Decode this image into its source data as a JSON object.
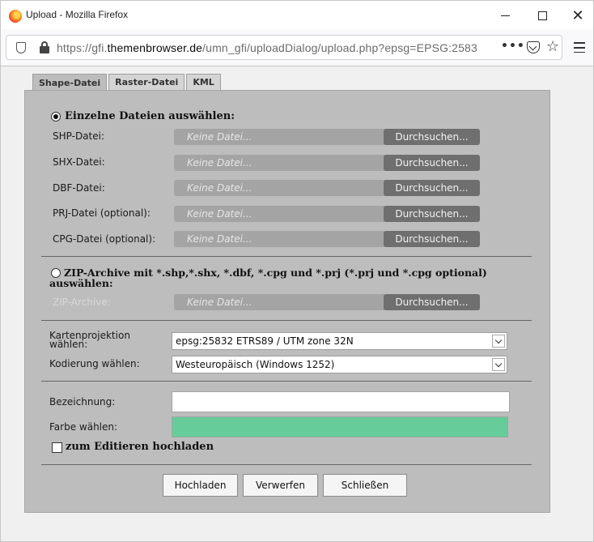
{
  "window": {
    "title": "Upload - Mozilla Firefox",
    "close_glyph": "✕"
  },
  "browser": {
    "url_prefix": "https://gfi.",
    "url_domain": "themenbrowser.de",
    "url_suffix": "/umn_gfi/uploadDialog/upload.php?epsg=EPSG:2583",
    "more_glyph": "•••",
    "star_glyph": "☆"
  },
  "tabs": [
    {
      "label": "Shape-Datei"
    },
    {
      "label": "Raster-Datei"
    },
    {
      "label": "KML"
    }
  ],
  "single_files": {
    "radio_label": "Einzelne Dateien auswählen:",
    "rows": [
      {
        "label": "SHP-Datei:",
        "placeholder": "Keine Datei...",
        "button": "Durchsuchen..."
      },
      {
        "label": "SHX-Datei:",
        "placeholder": "Keine Datei...",
        "button": "Durchsuchen..."
      },
      {
        "label": "DBF-Datei:",
        "placeholder": "Keine Datei...",
        "button": "Durchsuchen..."
      },
      {
        "label": "PRJ-Datei (optional):",
        "placeholder": "Keine Datei...",
        "button": "Durchsuchen..."
      },
      {
        "label": "CPG-Datei (optional):",
        "placeholder": "Keine Datei...",
        "button": "Durchsuchen..."
      }
    ]
  },
  "zip": {
    "radio_label_line1": "ZIP-Archive mit *.shp,*.shx, *.dbf, *.cpg und *.prj (*.prj und *.cpg optional)",
    "radio_label_line2": "auswählen:",
    "label": "ZIP-Archive:",
    "placeholder": "Keine Datei...",
    "button": "Durchsuchen..."
  },
  "projection": {
    "label_line1": "Kartenprojektion",
    "label_line2": "wählen:",
    "value": "epsg:25832 ETRS89 / UTM zone 32N"
  },
  "encoding": {
    "label": "Kodierung wählen:",
    "value": "Westeuropäisch (Windows 1252)"
  },
  "name": {
    "label": "Bezeichnung:",
    "value": ""
  },
  "color": {
    "label": "Farbe wählen:",
    "value": "#66cc99"
  },
  "edit_checkbox": {
    "label": "zum Editieren hochladen"
  },
  "actions": {
    "upload": "Hochladen",
    "discard": "Verwerfen",
    "close": "Schließen"
  }
}
